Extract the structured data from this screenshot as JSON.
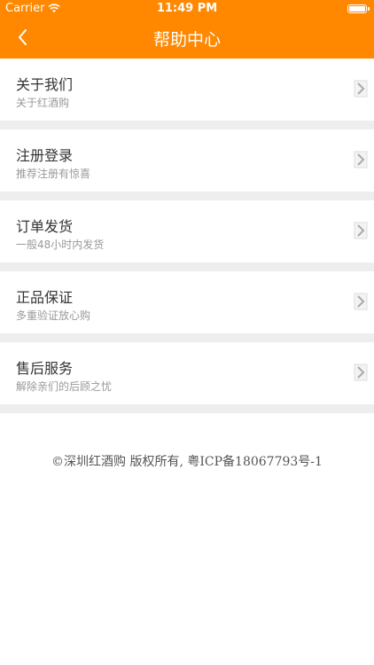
{
  "status_bar": {
    "carrier": "Carrier",
    "time": "11:49 PM"
  },
  "nav": {
    "title": "帮助中心",
    "back_icon": "chevron-left-icon"
  },
  "items": [
    {
      "title": "关于我们",
      "subtitle": "关于红酒购"
    },
    {
      "title": "注册登录",
      "subtitle": "推荐注册有惊喜"
    },
    {
      "title": "订单发货",
      "subtitle": "一般48小时内发货"
    },
    {
      "title": "正品保证",
      "subtitle": "多重验证放心购"
    },
    {
      "title": "售后服务",
      "subtitle": "解除亲们的后顾之忧"
    }
  ],
  "footer": {
    "copyright": "©深圳红酒购 版权所有, 粤ICP备18067793号-1"
  },
  "colors": {
    "accent": "#ff8800",
    "separator": "#eeeeee"
  }
}
